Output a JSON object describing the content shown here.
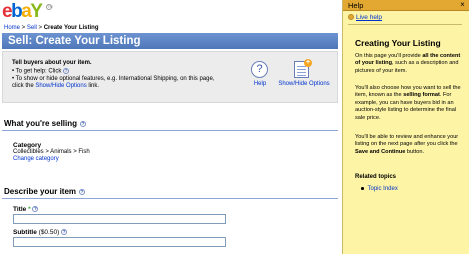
{
  "logo": {
    "e": "e",
    "b": "b",
    "a": "a",
    "y": "Y",
    "tm": "TM"
  },
  "breadcrumb": {
    "home": "Home",
    "sep1": " > ",
    "sell": "Sell",
    "sep2": " > ",
    "current": "Create Your Listing"
  },
  "page_title": "Sell: Create Your Listing",
  "info": {
    "heading": "Tell buyers about your item.",
    "line1_prefix": "• To get help: Click ",
    "line2": "• To show or hide optional features, e.g. International Shipping, on this page,",
    "line3_prefix": "click the ",
    "line3_link": "Show/Hide Options",
    "line3_suffix": " link."
  },
  "toolbar": {
    "help_label": "Help",
    "help_glyph": "?",
    "showhide_label": "Show/Hide Options",
    "plus_glyph": "+"
  },
  "sections": {
    "selling": {
      "title": "What you're selling"
    },
    "category": {
      "label": "Category",
      "path": "Collectibles > Animals > Fish",
      "change_link": "Change category"
    },
    "describe": {
      "title": "Describe your item"
    },
    "title_field": {
      "label": "Title",
      "required_mark": "*",
      "value": ""
    },
    "subtitle_field": {
      "label": "Subtitle",
      "hint": "($0.50)",
      "value": ""
    }
  },
  "help_panel": {
    "header": "Help",
    "close_glyph": "×",
    "live_help": "Live help",
    "title": "Creating Your Listing",
    "p1_a": "On this page you'll provide ",
    "p1_b": "all the content of your listing",
    "p1_c": ", such as a description and pictures of your item.",
    "p2_a": "You'll also choose how you want to sell the item, known as the ",
    "p2_b": "selling format",
    "p2_c": ". For example, you can have buyers bid in an auction-style listing to determine the final sale price.",
    "p3_a": "You'll be able to review and enhance your listing on the next page after you click the ",
    "p3_b": "Save and Continue",
    "p3_c": " button.",
    "related": "Related topics",
    "topic_index": "Topic Index"
  },
  "help_glyph_small": "?",
  "colors": {
    "title_bar": "#5d84c4",
    "help_panel_bg": "#fdf4a6",
    "help_header_bg": "#e3a832",
    "link": "#0033cc",
    "section_rule": "#8ea7d8"
  }
}
